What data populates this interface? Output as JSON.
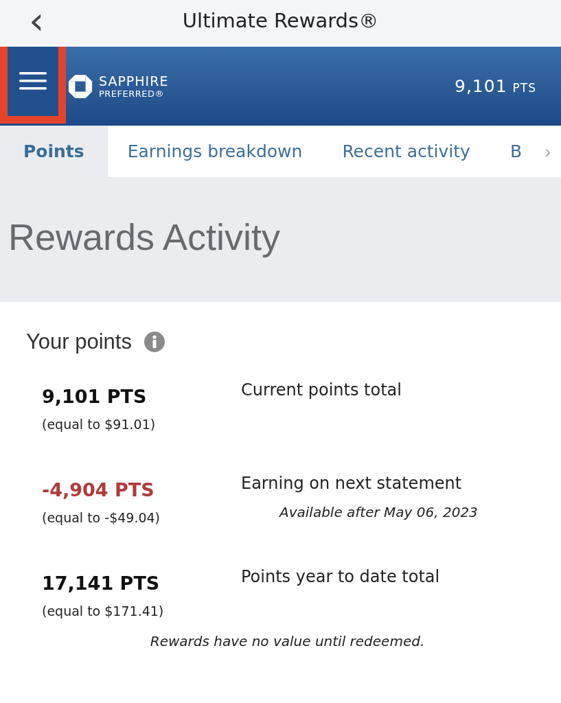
{
  "nav_bar": {
    "back": "‹",
    "title": "Ultimate Rewards®"
  },
  "banner": {
    "menu_highlighted": true,
    "brand_line_1": "SAPPHIRE",
    "brand_line_2": "PREFERRED®",
    "points": "9,101",
    "points_unit": "PTS"
  },
  "tabs": [
    {
      "label": "Points",
      "selected": true
    },
    {
      "label": "Earnings breakdown",
      "selected": false
    },
    {
      "label": "Recent activity",
      "selected": false
    },
    {
      "label": "B",
      "selected": false
    }
  ],
  "tabs_more": "›",
  "heading": "Rewards Activity",
  "section": {
    "title": "Your points",
    "rows": [
      {
        "amount": "9,101 PTS",
        "negative": false,
        "equivalent": "(equal to $91.01)",
        "label": "Current points total"
      },
      {
        "amount": "-4,904 PTS",
        "negative": true,
        "equivalent": "(equal to -$49.04)",
        "label": "Earning on next statement",
        "note": "Available after May 06, 2023"
      },
      {
        "amount": "17,141 PTS",
        "negative": false,
        "equivalent": "(equal to $171.41)",
        "label": "Points year to date total"
      }
    ],
    "disclaimer": "Rewards have no value until redeemed."
  }
}
